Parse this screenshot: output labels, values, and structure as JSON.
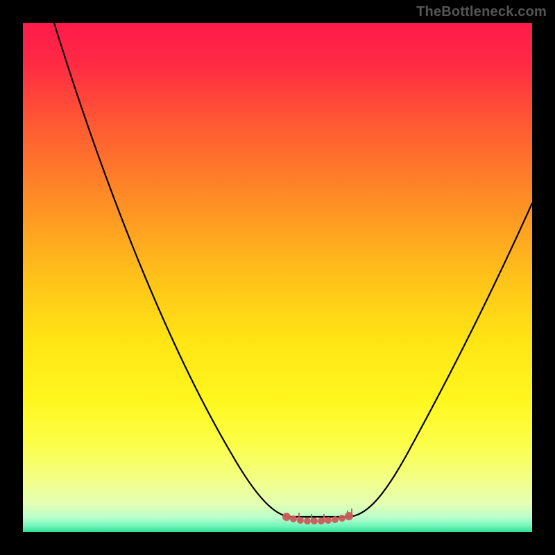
{
  "watermark": "TheBottleneck.com",
  "chart_data": {
    "type": "line",
    "title": "",
    "xlabel": "",
    "ylabel": "",
    "xlim": [
      0,
      100
    ],
    "ylim": [
      0,
      100
    ],
    "background_gradient": {
      "direction": "vertical",
      "stops": [
        {
          "pos": 0.0,
          "color": "#ff1b4b"
        },
        {
          "pos": 0.2,
          "color": "#ff5a33"
        },
        {
          "pos": 0.5,
          "color": "#ffc21a"
        },
        {
          "pos": 0.74,
          "color": "#fff71e"
        },
        {
          "pos": 0.9,
          "color": "#f2ff8a"
        },
        {
          "pos": 1.0,
          "color": "#2be08f"
        }
      ]
    },
    "series": [
      {
        "name": "bottleneck-curve",
        "color": "#000000",
        "x": [
          6,
          12,
          20,
          28,
          36,
          44,
          50,
          54,
          58,
          62,
          66,
          72,
          80,
          90,
          100
        ],
        "y": [
          100,
          80,
          60,
          44,
          30,
          18,
          8,
          3,
          2,
          2,
          3,
          10,
          25,
          45,
          65
        ]
      }
    ],
    "markers": [
      {
        "name": "optimal-range",
        "color": "#cc5a5a",
        "x_range": [
          52,
          64
        ],
        "y": 2
      }
    ],
    "grid": false,
    "legend": false
  }
}
